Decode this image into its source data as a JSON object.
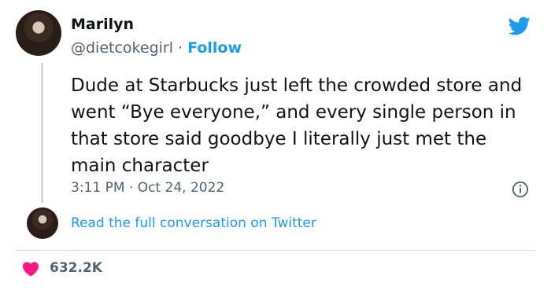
{
  "tweet": {
    "author_name": "Marilyn",
    "handle": "@dietcokegirl",
    "separator": "·",
    "follow_label": "Follow",
    "text": "Dude at Starbucks just left the crowded store and went “Bye everyone,” and every single person in that store said goodbye I literally just met the main character",
    "timestamp": "3:11 PM · Oct 24, 2022",
    "read_link": "Read the full conversation on Twitter",
    "likes": "632.2K"
  },
  "icons": {
    "brand": "twitter-bird-icon",
    "info": "info-icon",
    "like": "heart-icon"
  },
  "colors": {
    "accent": "#1d9bf0",
    "heart": "#f91880",
    "muted": "#536471",
    "text": "#0f1419"
  }
}
